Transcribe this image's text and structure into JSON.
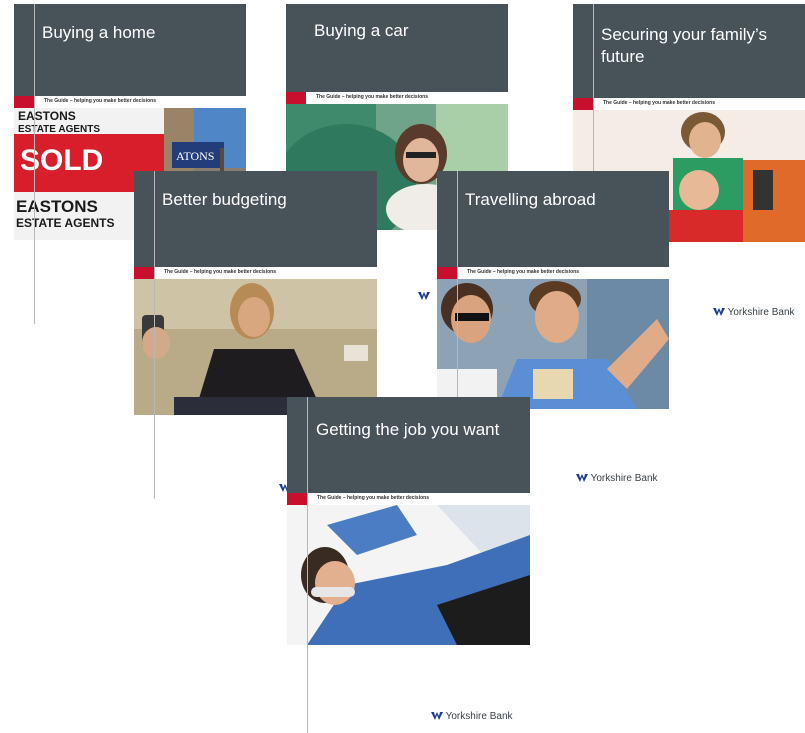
{
  "tagline": "The Guide – helping you make better decisions",
  "bank_name": "Yorkshire Bank",
  "brochures": {
    "home": {
      "title": "Buying a home",
      "sign_word_1": "EASTONS",
      "sign_word_2": "ESTATE AGENTS",
      "sign_sold": "SOLD",
      "sign_eastons_2": "EASTONS",
      "sign_agents_2": "ESTATE AGENTS",
      "sign_small": "ATONS"
    },
    "car": {
      "title": "Buying a car"
    },
    "family": {
      "title": "Securing your family’s future"
    },
    "budget": {
      "title": "Better budgeting"
    },
    "travel": {
      "title": "Travelling abroad"
    },
    "job": {
      "title": "Getting the job you want"
    }
  },
  "colors": {
    "header": "#475259",
    "accent_red": "#c8102e",
    "logo_blue": "#1f3d8a"
  }
}
